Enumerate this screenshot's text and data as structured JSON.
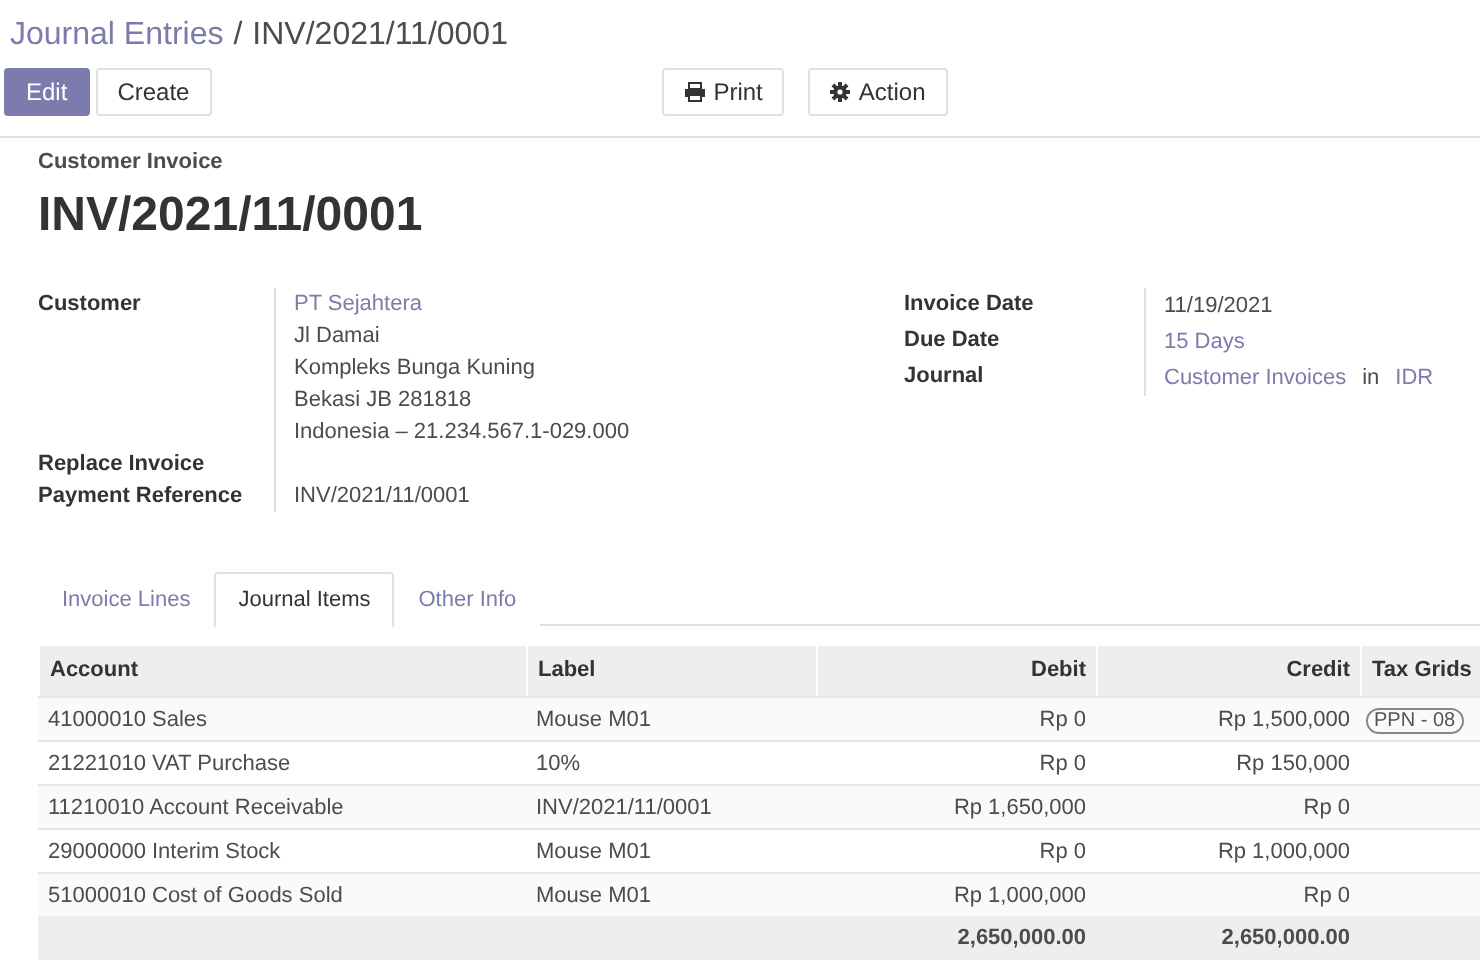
{
  "breadcrumb": {
    "parent": "Journal Entries",
    "separator": "/",
    "current": "INV/2021/11/0001"
  },
  "buttons": {
    "left": [
      {
        "label": "Edit",
        "kind": "primary"
      },
      {
        "label": "Create",
        "kind": "secondary"
      }
    ],
    "right": [
      {
        "label": "Print",
        "kind": "print"
      },
      {
        "label": "Action",
        "kind": "action"
      }
    ]
  },
  "form": {
    "type_label": "Customer Invoice",
    "title": "INV/2021/11/0001",
    "left_fields": [
      {
        "label": "Customer",
        "lines": [
          {
            "text": "PT Sejahtera",
            "link": true
          },
          {
            "text": "Jl Damai",
            "link": false
          },
          {
            "text": "Kompleks Bunga Kuning",
            "link": false
          },
          {
            "text": "Bekasi JB 281818",
            "link": false
          },
          {
            "text": "Indonesia – 21.234.567.1-029.000",
            "link": false
          }
        ]
      },
      {
        "label": "Replace Invoice"
      },
      {
        "label": "Payment Reference",
        "lines": [
          {
            "text": "INV/2021/11/0001",
            "link": false
          }
        ]
      }
    ],
    "right_fields": [
      {
        "label": "Invoice Date",
        "parts": [
          {
            "text": "11/19/2021",
            "link": false
          }
        ]
      },
      {
        "label": "Due Date",
        "parts": [
          {
            "text": "15 Days",
            "link": true
          }
        ]
      },
      {
        "label": "Journal",
        "parts": [
          {
            "text": "Customer Invoices",
            "link": true
          },
          {
            "text": "in",
            "link": false
          },
          {
            "text": "IDR",
            "link": true
          }
        ]
      }
    ]
  },
  "tabs": [
    {
      "label": "Invoice Lines",
      "selected": false
    },
    {
      "label": "Journal Items",
      "selected": true
    },
    {
      "label": "Other Info",
      "selected": false
    }
  ],
  "table": {
    "columns": [
      "Account",
      "Label",
      "Debit",
      "Credit",
      "Tax Grids"
    ],
    "rows": [
      {
        "account": "41000010 Sales",
        "label": "Mouse M01",
        "debit": "Rp 0",
        "credit": "Rp 1,500,000",
        "tax_grid": "PPN - 08"
      },
      {
        "account": "21221010 VAT Purchase",
        "label": "10%",
        "debit": "Rp 0",
        "credit": "Rp 150,000"
      },
      {
        "account": "11210010 Account Receivable",
        "label": "INV/2021/11/0001",
        "debit": "Rp 1,650,000",
        "credit": "Rp 0"
      },
      {
        "account": "29000000 Interim Stock",
        "label": "Mouse M01",
        "debit": "Rp 0",
        "credit": "Rp 1,000,000"
      },
      {
        "account": "51000010 Cost of Goods Sold",
        "label": "Mouse M01",
        "debit": "Rp 1,000,000",
        "credit": "Rp 0"
      }
    ],
    "totals": {
      "debit": "2,650,000.00",
      "credit": "2,650,000.00"
    }
  }
}
